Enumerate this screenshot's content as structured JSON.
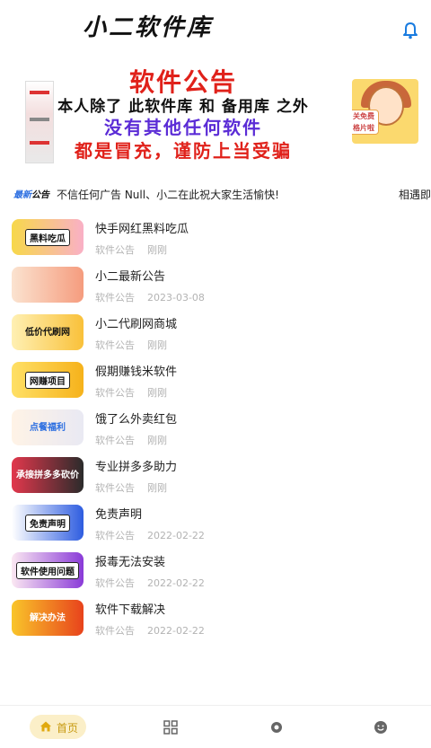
{
  "header": {
    "title": "小二软件库",
    "bell_icon": "bell-icon",
    "accent_color": "#1a7ce0"
  },
  "banner": {
    "line1": "软件公告",
    "line2": "本人除了 此软件库 和 备用库 之外",
    "line3": "没有其他任何软件",
    "line4": "都是冒充，谨防上当受骗",
    "side_tag": "关免费 格片啦"
  },
  "notice": {
    "tag_prefix": "最新",
    "tag_suffix": "公告",
    "text": "不信任何广告 Null、小二在此祝大家生活愉快!",
    "trailing_text": "相遇即"
  },
  "articles": [
    {
      "title": "快手网红黑料吃瓜",
      "category": "软件公告",
      "time": "刚刚",
      "thumb_text": "黑料吃瓜"
    },
    {
      "title": "小二最新公告",
      "category": "软件公告",
      "time": "2023-03-08",
      "thumb_text": ""
    },
    {
      "title": "小二代刷网商城",
      "category": "软件公告",
      "time": "刚刚",
      "thumb_text": "低价代刷网"
    },
    {
      "title": "假期赚钱米软件",
      "category": "软件公告",
      "time": "刚刚",
      "thumb_text": "网赚项目"
    },
    {
      "title": "饿了么外卖红包",
      "category": "软件公告",
      "time": "刚刚",
      "thumb_text": "点餐福利"
    },
    {
      "title": "专业拼多多助力",
      "category": "软件公告",
      "time": "刚刚",
      "thumb_text": "承接拼多多砍价"
    },
    {
      "title": "免责声明",
      "category": "软件公告",
      "time": "2022-02-22",
      "thumb_text": "免责声明"
    },
    {
      "title": "报毒无法安装",
      "category": "软件公告",
      "time": "2022-02-22",
      "thumb_text": "软件使用问题"
    },
    {
      "title": "软件下载解决",
      "category": "软件公告",
      "time": "2022-02-22",
      "thumb_text": "解决办法"
    }
  ],
  "bottom_nav": {
    "home_label": "首页",
    "home_icon": "home-icon",
    "category_icon": "grid-icon",
    "discover_icon": "compass-icon",
    "profile_icon": "smile-icon",
    "active_color": "#c79a10",
    "active_bg": "#fbefc8"
  }
}
